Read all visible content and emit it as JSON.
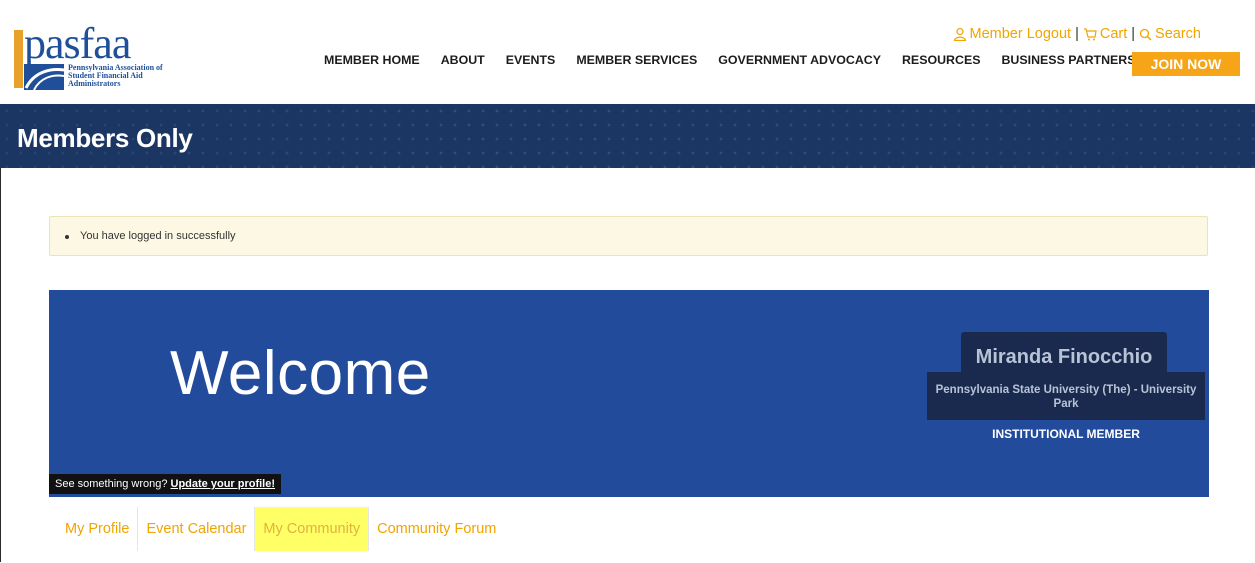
{
  "header": {
    "logo_text": "pasfaa",
    "logo_subtitle": [
      "Pennsylvania Association of",
      "Student Financial Aid",
      "Administrators"
    ],
    "utility": {
      "logout": "Member Logout",
      "cart": "Cart",
      "search": "Search",
      "sep": "|"
    },
    "nav": [
      "MEMBER HOME",
      "ABOUT",
      "EVENTS",
      "MEMBER SERVICES",
      "GOVERNMENT ADVOCACY",
      "RESOURCES",
      "BUSINESS PARTNERS"
    ],
    "join_label": "JOIN NOW"
  },
  "banner": {
    "title": "Members Only"
  },
  "alert": {
    "message": "You have logged in successfully"
  },
  "welcome": {
    "heading": "Welcome",
    "name": "Miranda Finocchio",
    "organization": "Pennsylvania State University (The) - University Park",
    "membership": "INSTITUTIONAL MEMBER",
    "wrong_text": "See something wrong?",
    "update_link": "Update your profile!"
  },
  "tabs": [
    {
      "label": "My Profile",
      "highlighted": false
    },
    {
      "label": "Event Calendar",
      "highlighted": false
    },
    {
      "label": "My Community",
      "highlighted": true
    },
    {
      "label": "Community Forum",
      "highlighted": false
    }
  ],
  "colors": {
    "accent": "#f5a517",
    "navy": "#1c3664",
    "welcome_blue": "#224c9b",
    "alert_bg": "#fcf8e3",
    "highlight": "#ffff66"
  }
}
